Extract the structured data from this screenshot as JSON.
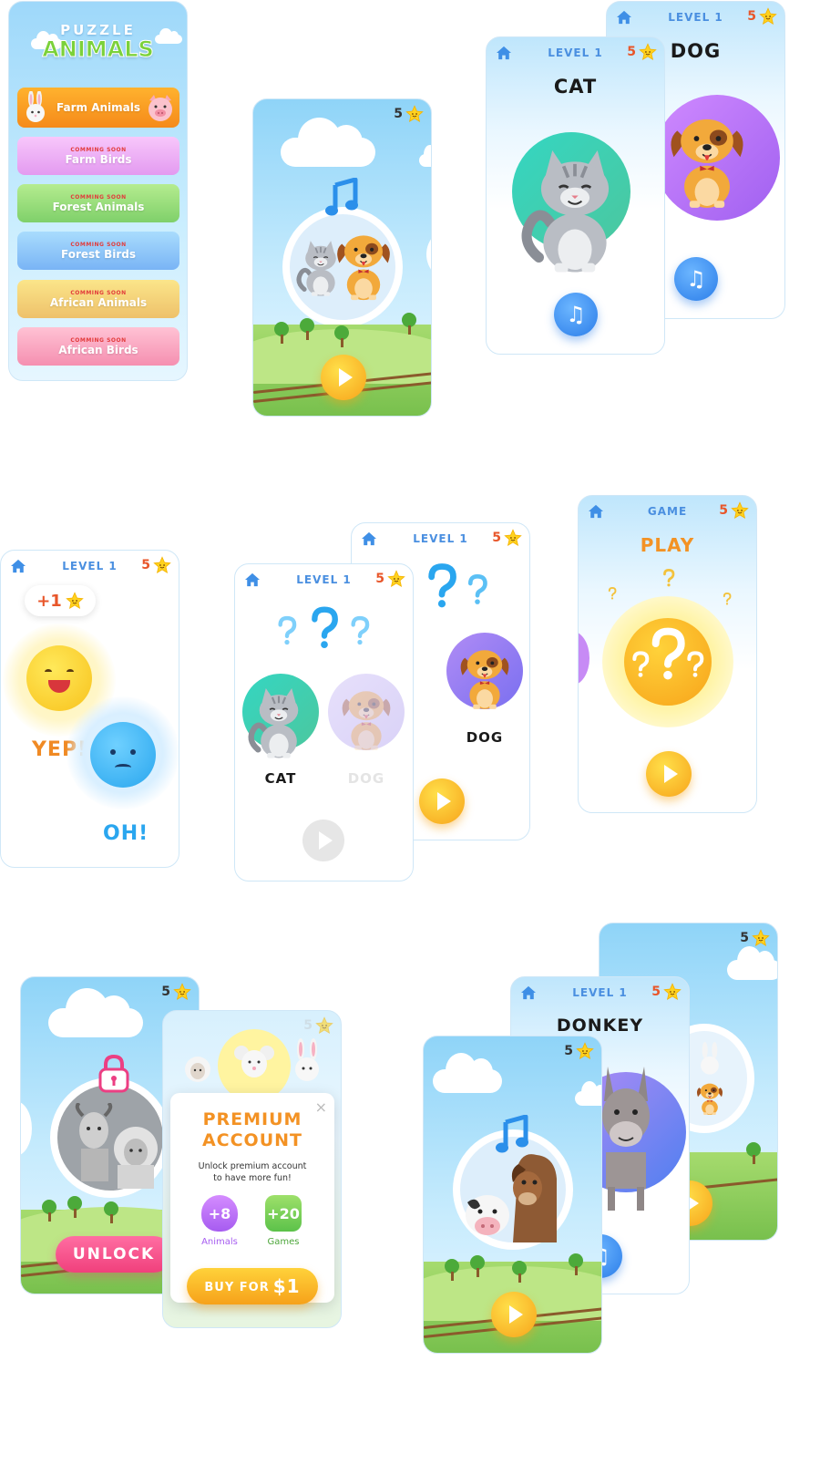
{
  "menu": {
    "logo_line1": "PUZZLE",
    "logo_line2": "ANIMALS",
    "items": [
      {
        "soon": "",
        "name": "Farm Animals"
      },
      {
        "soon": "COMMING SOON",
        "name": "Farm Birds"
      },
      {
        "soon": "COMMING SOON",
        "name": "Forest Animals"
      },
      {
        "soon": "COMMING SOON",
        "name": "Forest Birds"
      },
      {
        "soon": "COMMING SOON",
        "name": "African Animals"
      },
      {
        "soon": "COMMING SOON",
        "name": "African Birds"
      }
    ]
  },
  "score": "5",
  "score_faded": "5",
  "level": "LEVEL 1",
  "game_label": "GAME",
  "cards": {
    "cat": "CAT",
    "dog": "DOG",
    "donkey": "DONKEY"
  },
  "feedback": {
    "plus": "+1",
    "yep": "YEP!",
    "oh": "OH!"
  },
  "quiz": {
    "cat": "CAT",
    "dog": "DOG",
    "dog_faded": "DOG"
  },
  "game": {
    "play": "PLAY"
  },
  "premium": {
    "unlock": "UNLOCK",
    "title_line1": "PREMIUM",
    "title_line2": "ACCOUNT",
    "desc_line1": "Unlock premium account",
    "desc_line2": "to have more fun!",
    "animals_count": "+8",
    "animals_label": "Animals",
    "games_count": "+20",
    "games_label": "Games",
    "buy_label": "BUY FOR",
    "buy_price": "$1",
    "close": "×"
  },
  "icons": {
    "home": "home-icon",
    "star": "star-icon",
    "music": "music-note-icon",
    "play": "play-icon",
    "lock": "lock-icon"
  },
  "colors": {
    "accent_orange": "#f7a31a",
    "accent_blue": "#2b7de9",
    "level_text": "#4a8fe0",
    "score_text": "#e8562a",
    "pink": "#f0407c"
  }
}
